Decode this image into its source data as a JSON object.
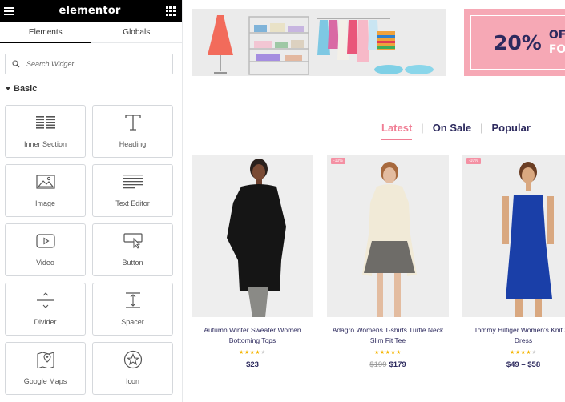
{
  "panel": {
    "brand": "elementor",
    "tabs": [
      {
        "label": "Elements",
        "active": true
      },
      {
        "label": "Globals",
        "active": false
      }
    ],
    "search_placeholder": "Search Widget...",
    "category": "Basic",
    "widgets": [
      {
        "label": "Inner Section",
        "icon": "inner-section-icon"
      },
      {
        "label": "Heading",
        "icon": "heading-icon"
      },
      {
        "label": "Image",
        "icon": "image-icon"
      },
      {
        "label": "Text Editor",
        "icon": "text-editor-icon"
      },
      {
        "label": "Video",
        "icon": "video-icon"
      },
      {
        "label": "Button",
        "icon": "button-icon"
      },
      {
        "label": "Divider",
        "icon": "divider-icon"
      },
      {
        "label": "Spacer",
        "icon": "spacer-icon"
      },
      {
        "label": "Google Maps",
        "icon": "google-maps-icon"
      },
      {
        "label": "Icon",
        "icon": "star-icon"
      }
    ]
  },
  "canvas": {
    "promo": {
      "percent": "20%",
      "line1": "OF",
      "line2": "FO"
    },
    "filter_tabs": [
      {
        "label": "Latest",
        "active": true
      },
      {
        "label": "On Sale",
        "active": false
      },
      {
        "label": "Popular",
        "active": false
      }
    ],
    "products": [
      {
        "name_line1": "Autumn Winter Sweater Women",
        "name_line2": "Bottoming Tops",
        "rating": 4,
        "price": "$23",
        "old_price": "",
        "badge": ""
      },
      {
        "name_line1": "Adagro Womens T-shirts Turtle Neck",
        "name_line2": "Slim Fit Tee",
        "rating": 5,
        "price": "$179",
        "old_price": "$199",
        "badge": "-10%"
      },
      {
        "name_line1": "Tommy Hilfiger Women's Knit Sh",
        "name_line2": "Dress",
        "rating": 4,
        "price": "$49 – $58",
        "old_price": "",
        "badge": "-10%"
      }
    ]
  },
  "colors": {
    "navy": "#2d2a5e",
    "pink": "#f07d94",
    "promo_bg": "#f6a8b5",
    "star": "#f4b400"
  }
}
